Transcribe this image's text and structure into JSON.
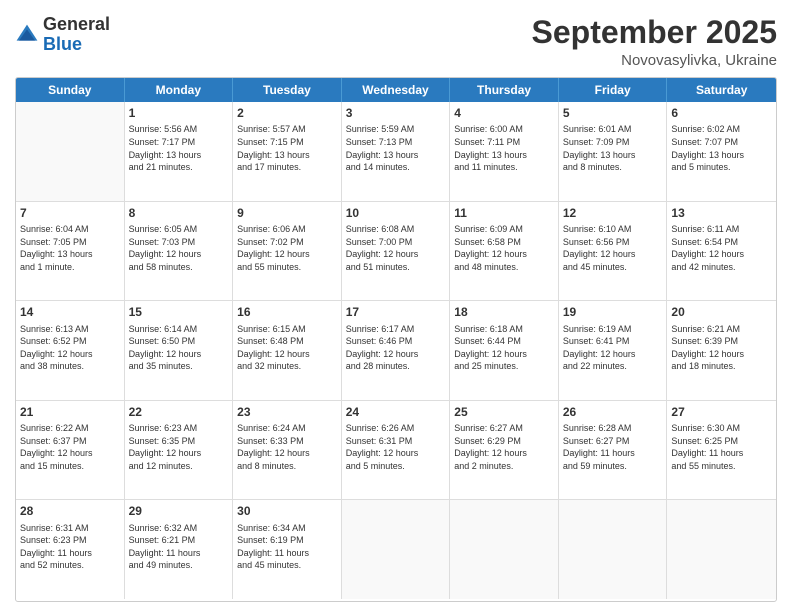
{
  "header": {
    "logo_general": "General",
    "logo_blue": "Blue",
    "month_title": "September 2025",
    "location": "Novovasylivka, Ukraine"
  },
  "days_of_week": [
    "Sunday",
    "Monday",
    "Tuesday",
    "Wednesday",
    "Thursday",
    "Friday",
    "Saturday"
  ],
  "rows": [
    [
      {
        "day": "",
        "info": ""
      },
      {
        "day": "1",
        "info": "Sunrise: 5:56 AM\nSunset: 7:17 PM\nDaylight: 13 hours\nand 21 minutes."
      },
      {
        "day": "2",
        "info": "Sunrise: 5:57 AM\nSunset: 7:15 PM\nDaylight: 13 hours\nand 17 minutes."
      },
      {
        "day": "3",
        "info": "Sunrise: 5:59 AM\nSunset: 7:13 PM\nDaylight: 13 hours\nand 14 minutes."
      },
      {
        "day": "4",
        "info": "Sunrise: 6:00 AM\nSunset: 7:11 PM\nDaylight: 13 hours\nand 11 minutes."
      },
      {
        "day": "5",
        "info": "Sunrise: 6:01 AM\nSunset: 7:09 PM\nDaylight: 13 hours\nand 8 minutes."
      },
      {
        "day": "6",
        "info": "Sunrise: 6:02 AM\nSunset: 7:07 PM\nDaylight: 13 hours\nand 5 minutes."
      }
    ],
    [
      {
        "day": "7",
        "info": "Sunrise: 6:04 AM\nSunset: 7:05 PM\nDaylight: 13 hours\nand 1 minute."
      },
      {
        "day": "8",
        "info": "Sunrise: 6:05 AM\nSunset: 7:03 PM\nDaylight: 12 hours\nand 58 minutes."
      },
      {
        "day": "9",
        "info": "Sunrise: 6:06 AM\nSunset: 7:02 PM\nDaylight: 12 hours\nand 55 minutes."
      },
      {
        "day": "10",
        "info": "Sunrise: 6:08 AM\nSunset: 7:00 PM\nDaylight: 12 hours\nand 51 minutes."
      },
      {
        "day": "11",
        "info": "Sunrise: 6:09 AM\nSunset: 6:58 PM\nDaylight: 12 hours\nand 48 minutes."
      },
      {
        "day": "12",
        "info": "Sunrise: 6:10 AM\nSunset: 6:56 PM\nDaylight: 12 hours\nand 45 minutes."
      },
      {
        "day": "13",
        "info": "Sunrise: 6:11 AM\nSunset: 6:54 PM\nDaylight: 12 hours\nand 42 minutes."
      }
    ],
    [
      {
        "day": "14",
        "info": "Sunrise: 6:13 AM\nSunset: 6:52 PM\nDaylight: 12 hours\nand 38 minutes."
      },
      {
        "day": "15",
        "info": "Sunrise: 6:14 AM\nSunset: 6:50 PM\nDaylight: 12 hours\nand 35 minutes."
      },
      {
        "day": "16",
        "info": "Sunrise: 6:15 AM\nSunset: 6:48 PM\nDaylight: 12 hours\nand 32 minutes."
      },
      {
        "day": "17",
        "info": "Sunrise: 6:17 AM\nSunset: 6:46 PM\nDaylight: 12 hours\nand 28 minutes."
      },
      {
        "day": "18",
        "info": "Sunrise: 6:18 AM\nSunset: 6:44 PM\nDaylight: 12 hours\nand 25 minutes."
      },
      {
        "day": "19",
        "info": "Sunrise: 6:19 AM\nSunset: 6:41 PM\nDaylight: 12 hours\nand 22 minutes."
      },
      {
        "day": "20",
        "info": "Sunrise: 6:21 AM\nSunset: 6:39 PM\nDaylight: 12 hours\nand 18 minutes."
      }
    ],
    [
      {
        "day": "21",
        "info": "Sunrise: 6:22 AM\nSunset: 6:37 PM\nDaylight: 12 hours\nand 15 minutes."
      },
      {
        "day": "22",
        "info": "Sunrise: 6:23 AM\nSunset: 6:35 PM\nDaylight: 12 hours\nand 12 minutes."
      },
      {
        "day": "23",
        "info": "Sunrise: 6:24 AM\nSunset: 6:33 PM\nDaylight: 12 hours\nand 8 minutes."
      },
      {
        "day": "24",
        "info": "Sunrise: 6:26 AM\nSunset: 6:31 PM\nDaylight: 12 hours\nand 5 minutes."
      },
      {
        "day": "25",
        "info": "Sunrise: 6:27 AM\nSunset: 6:29 PM\nDaylight: 12 hours\nand 2 minutes."
      },
      {
        "day": "26",
        "info": "Sunrise: 6:28 AM\nSunset: 6:27 PM\nDaylight: 11 hours\nand 59 minutes."
      },
      {
        "day": "27",
        "info": "Sunrise: 6:30 AM\nSunset: 6:25 PM\nDaylight: 11 hours\nand 55 minutes."
      }
    ],
    [
      {
        "day": "28",
        "info": "Sunrise: 6:31 AM\nSunset: 6:23 PM\nDaylight: 11 hours\nand 52 minutes."
      },
      {
        "day": "29",
        "info": "Sunrise: 6:32 AM\nSunset: 6:21 PM\nDaylight: 11 hours\nand 49 minutes."
      },
      {
        "day": "30",
        "info": "Sunrise: 6:34 AM\nSunset: 6:19 PM\nDaylight: 11 hours\nand 45 minutes."
      },
      {
        "day": "",
        "info": ""
      },
      {
        "day": "",
        "info": ""
      },
      {
        "day": "",
        "info": ""
      },
      {
        "day": "",
        "info": ""
      }
    ]
  ]
}
